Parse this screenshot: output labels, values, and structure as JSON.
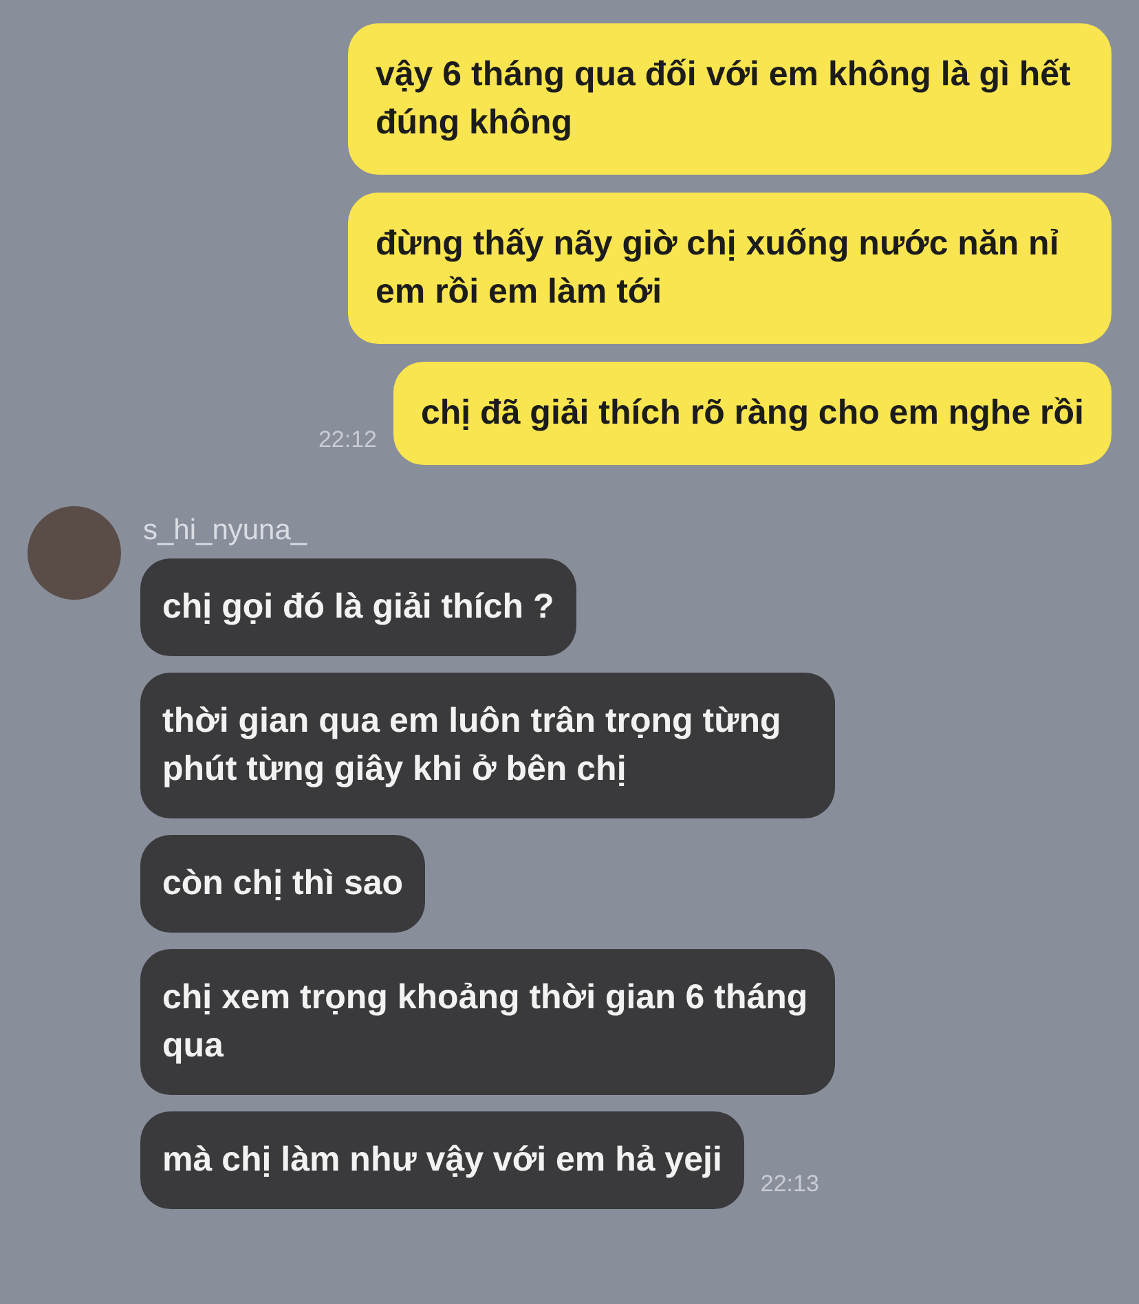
{
  "outgoing": {
    "messages": [
      "vậy 6 tháng qua đối với em không là gì hết đúng không",
      "đừng thấy nãy giờ chị xuống nước năn nỉ em rồi em làm tới",
      "chị đã giải thích rõ ràng cho em nghe rồi"
    ],
    "time": "22:12"
  },
  "incoming": {
    "sender": "s_hi_nyuna_",
    "messages": [
      "chị gọi đó là giải thích ?",
      "thời gian qua em luôn trân trọng từng phút từng giây khi ở bên chị",
      "còn chị thì sao",
      "chị xem trọng khoảng thời gian 6 tháng qua",
      "mà chị làm như vậy với em hả yeji"
    ],
    "time": "22:13"
  }
}
